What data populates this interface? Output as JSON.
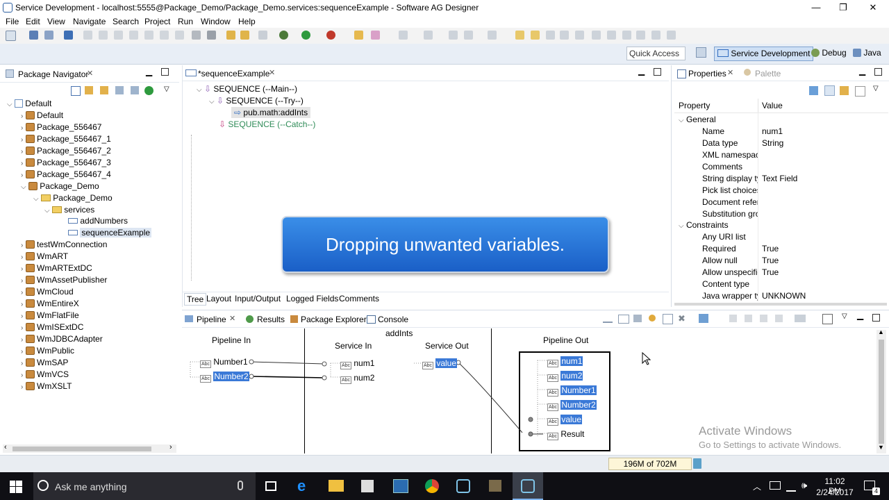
{
  "window": {
    "title": "Service Development - localhost:5555@Package_Demo/Package_Demo.services:sequenceExample - Software AG Designer",
    "min_glyph": "—",
    "max_glyph": "❐",
    "close_glyph": "✕"
  },
  "menu": [
    "File",
    "Edit",
    "View",
    "Navigate",
    "Search",
    "Project",
    "Run",
    "Window",
    "Help"
  ],
  "perspectives": {
    "quick_access_placeholder": "Quick Access",
    "items": [
      "Service Development",
      "Debug",
      "Java"
    ]
  },
  "navigator": {
    "tab": "Package Navigator",
    "root": "Default",
    "packages": [
      "Default",
      "Package_556467",
      "Package_556467_1",
      "Package_556467_2",
      "Package_556467_3",
      "Package_556467_4",
      "Package_Demo"
    ],
    "demo_folder": "Package_Demo",
    "services_folder": "services",
    "services": [
      "addNumbers",
      "sequenceExample"
    ],
    "more_packages": [
      "testWmConnection",
      "WmART",
      "WmARTExtDC",
      "WmAssetPublisher",
      "WmCloud",
      "WmEntireX",
      "WmFlatFile",
      "WmISExtDC",
      "WmJDBCAdapter",
      "WmPublic",
      "WmSAP",
      "WmVCS",
      "WmXSLT"
    ]
  },
  "editor": {
    "tab": "*sequenceExample",
    "steps": [
      "SEQUENCE (--Main--)",
      "SEQUENCE (--Try--)",
      "pub.math:addInts",
      "SEQUENCE (--Catch--)"
    ],
    "bottom_tabs": [
      "Tree",
      "Layout",
      "Input/Output",
      "Logged Fields",
      "Comments"
    ]
  },
  "overlay": {
    "text": "Dropping unwanted variables."
  },
  "properties": {
    "tab": "Properties",
    "palette_tab": "Palette",
    "col_property": "Property",
    "col_value": "Value",
    "general_label": "General",
    "general": [
      {
        "name": "Name",
        "value": "num1"
      },
      {
        "name": "Data type",
        "value": "String"
      },
      {
        "name": "XML namespace",
        "value": ""
      },
      {
        "name": "Comments",
        "value": ""
      },
      {
        "name": "String display typ",
        "value": "Text Field"
      },
      {
        "name": "Pick list choices",
        "value": ""
      },
      {
        "name": "Document refere",
        "value": ""
      },
      {
        "name": "Substitution gro",
        "value": ""
      }
    ],
    "constraints_label": "Constraints",
    "constraints": [
      {
        "name": "Any URI list",
        "value": ""
      },
      {
        "name": "Required",
        "value": "True"
      },
      {
        "name": "Allow null",
        "value": "True"
      },
      {
        "name": "Allow unspecifie",
        "value": "True"
      },
      {
        "name": "Content type",
        "value": ""
      },
      {
        "name": "Java wrapper typ",
        "value": "UNKNOWN"
      }
    ]
  },
  "bottom_tabs": [
    "Pipeline",
    "Results",
    "Package Explorer",
    "Console"
  ],
  "pipeline": {
    "pipeline_in": "Pipeline In",
    "addints": "addInts",
    "service_in": "Service In",
    "service_out": "Service Out",
    "pipeline_out": "Pipeline Out",
    "in_vars": [
      "Number1",
      "Number2"
    ],
    "service_in_vars": [
      "num1",
      "num2"
    ],
    "service_out_vars": [
      "value"
    ],
    "out_vars": [
      "num1",
      "num2",
      "Number1",
      "Number2",
      "value",
      "Result"
    ]
  },
  "watermark": {
    "line1": "Activate Windows",
    "line2": "Go to Settings to activate Windows."
  },
  "status": {
    "memory": "196M of 702M"
  },
  "taskbar": {
    "search": "Ask me anything",
    "time": "11:02 PM",
    "date": "2/24/2017",
    "notif_count": "4"
  }
}
